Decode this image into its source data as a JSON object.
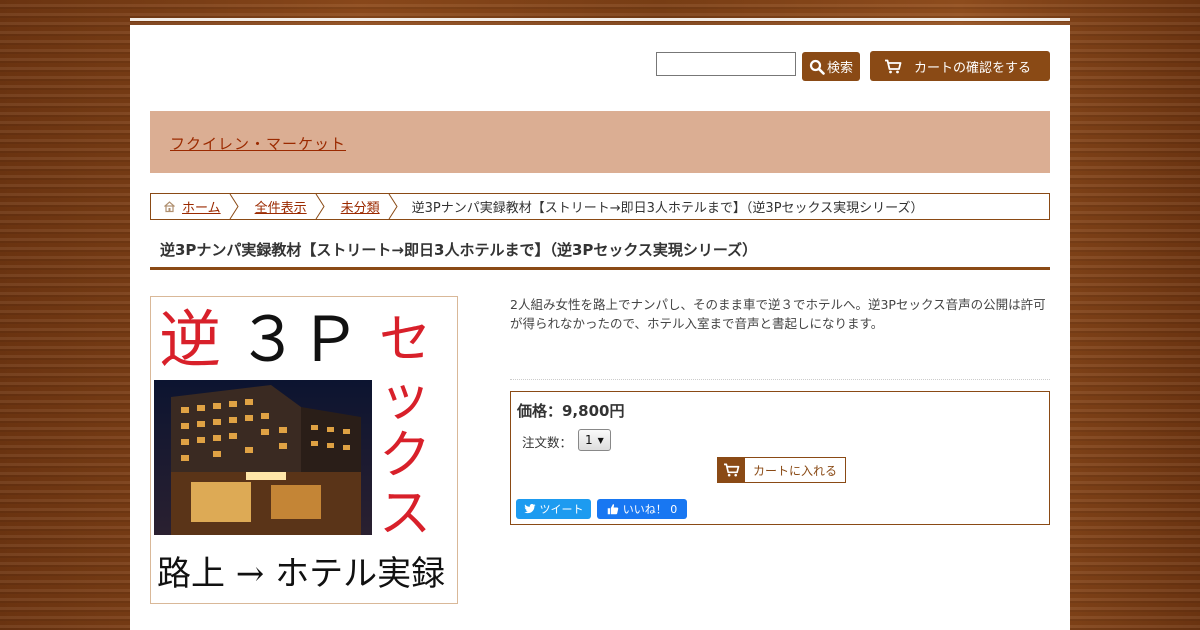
{
  "header": {
    "search": {
      "value": "",
      "placeholder": ""
    },
    "search_button_label": "検索",
    "cart_button_label": "カートの確認をする"
  },
  "banner": {
    "shop_name": "フクイレン・マーケット"
  },
  "breadcrumb": {
    "items": [
      "ホーム",
      "全件表示",
      "未分類"
    ],
    "current": "逆3Pナンパ実録教材【ストリート→即日3人ホテルまで】（逆3Pセックス実現シリーズ）"
  },
  "product": {
    "title": "逆3Pナンパ実録教材【ストリート→即日3人ホテルまで】（逆3Pセックス実現シリーズ）",
    "image_text": {
      "line1_red": "逆",
      "line1_black": "３Ｐ",
      "vertical_red": "セックス",
      "bottom": "路上 → ホテル実録"
    },
    "description": "2人組み女性を路上でナンパし、そのまま車で逆３でホテルへ。逆3Pセックス音声の公開は許可が得られなかったので、ホテル入室まで音声と書起しになります。",
    "price_label": "価格：9,800円",
    "qty_label": "注文数：",
    "qty_value": "1",
    "add_to_cart_label": "カートに入れる",
    "tweet_label": "ツイート",
    "like_label": "いいね！ 0"
  },
  "colors": {
    "accent_brown": "#8a4a15",
    "banner_bg": "#dbae93",
    "link_red": "#9b2a00",
    "twitter_blue": "#1d9bf0",
    "facebook_blue": "#1877f2"
  }
}
